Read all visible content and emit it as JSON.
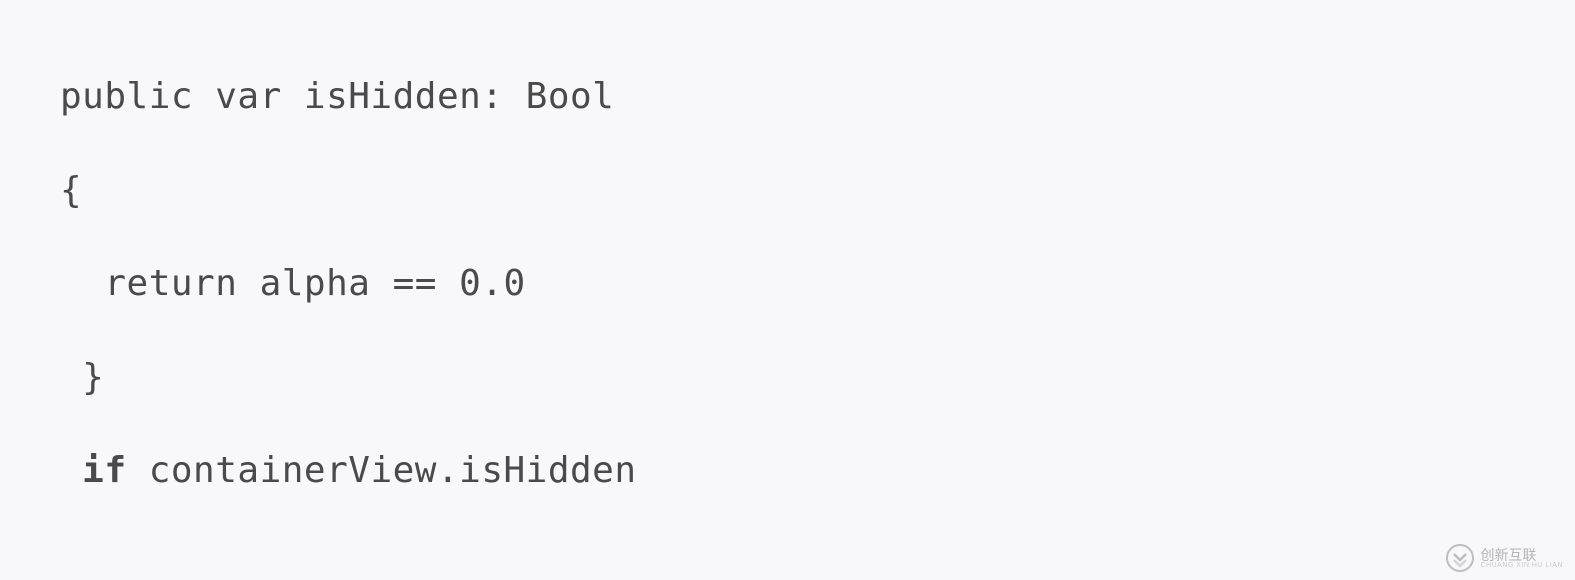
{
  "code": {
    "line1": "public var isHidden: Bool",
    "line2": "{",
    "line3": "  return alpha == 0.0",
    "line4": " }",
    "line5_kw": " if",
    "line5_rest": " containerView.isHidden"
  },
  "watermark": {
    "main": "创新互联",
    "sub": "CHUANG XIN HU LIAN"
  }
}
